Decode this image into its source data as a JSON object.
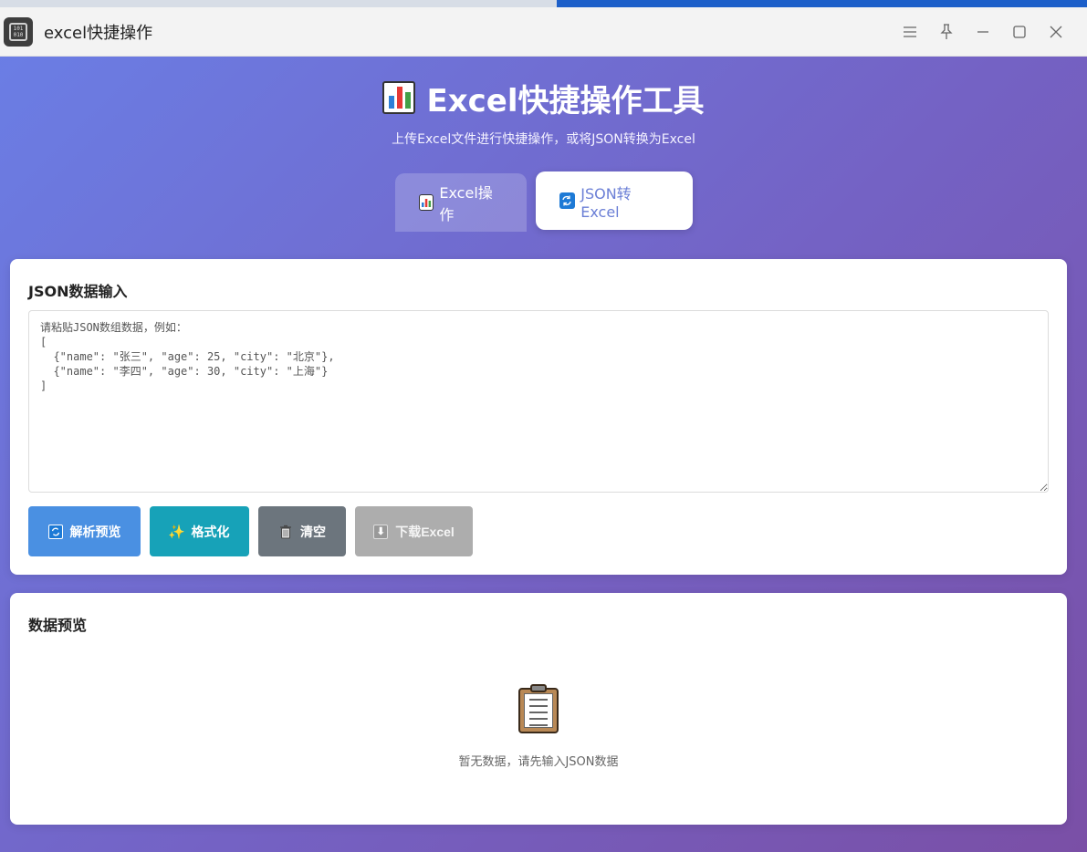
{
  "window": {
    "title": "excel快捷操作",
    "app_icon": "binary-chip-icon",
    "controls": [
      "menu-icon",
      "pin-icon",
      "minimize-icon",
      "maximize-icon",
      "close-icon"
    ]
  },
  "header": {
    "title": "Excel快捷操作工具",
    "title_icon": "bar-chart-icon",
    "subtitle": "上传Excel文件进行快捷操作，或将JSON转换为Excel"
  },
  "tabs": [
    {
      "label": "Excel操作",
      "icon": "bar-chart-icon",
      "active": false
    },
    {
      "label": "JSON转Excel",
      "icon": "sync-icon",
      "active": true
    }
  ],
  "json_input": {
    "title": "JSON数据输入",
    "placeholder": "请粘贴JSON数组数据，例如：\n[\n  {\"name\": \"张三\", \"age\": 25, \"city\": \"北京\"},\n  {\"name\": \"李四\", \"age\": 30, \"city\": \"上海\"}\n]",
    "value": ""
  },
  "buttons": {
    "parse": {
      "label": "解析预览",
      "icon": "sync-icon"
    },
    "format": {
      "label": "格式化",
      "icon": "sparkles-icon"
    },
    "clear": {
      "label": "清空",
      "icon": "trash-icon"
    },
    "download": {
      "label": "下载Excel",
      "icon": "download-icon",
      "disabled": true
    }
  },
  "preview": {
    "title": "数据预览",
    "empty_icon": "clipboard-icon",
    "empty_text": "暂无数据，请先输入JSON数据"
  },
  "colors": {
    "bg_gradient_start": "#6a7fe6",
    "bg_gradient_end": "#7a4fa6",
    "accent": "#6b7fd6",
    "parse_button": "#4a90e2",
    "format_button": "#17a2b8",
    "clear_button": "#6c757d",
    "download_button_disabled": "#adadad"
  }
}
